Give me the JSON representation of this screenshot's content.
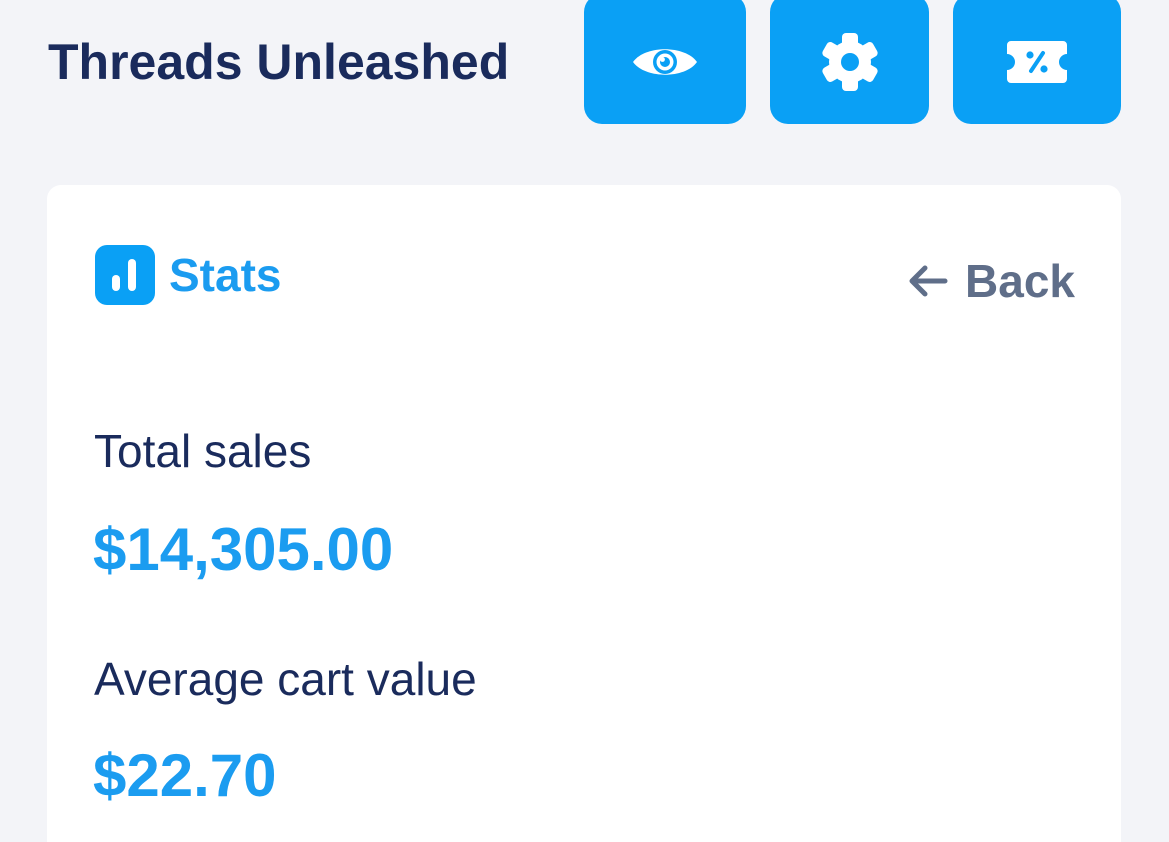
{
  "header": {
    "store_name": "Threads Unleashed",
    "buttons": [
      {
        "icon": "eye-icon",
        "action": "preview"
      },
      {
        "icon": "gear-icon",
        "action": "settings"
      },
      {
        "icon": "discount-ticket-icon",
        "action": "discounts"
      }
    ]
  },
  "stats": {
    "title": "Stats",
    "icon": "bar-chart-icon",
    "back_label": "Back",
    "metrics": [
      {
        "label": "Total sales",
        "value": "$14,305.00"
      },
      {
        "label": "Average cart value",
        "value": "$22.70"
      }
    ]
  },
  "colors": {
    "background": "#f3f4f8",
    "accent": "#0aa0f5",
    "accent_text": "#1b9cf0",
    "title_text": "#1a2b5c",
    "muted_text": "#5f6e89",
    "card": "#ffffff"
  }
}
